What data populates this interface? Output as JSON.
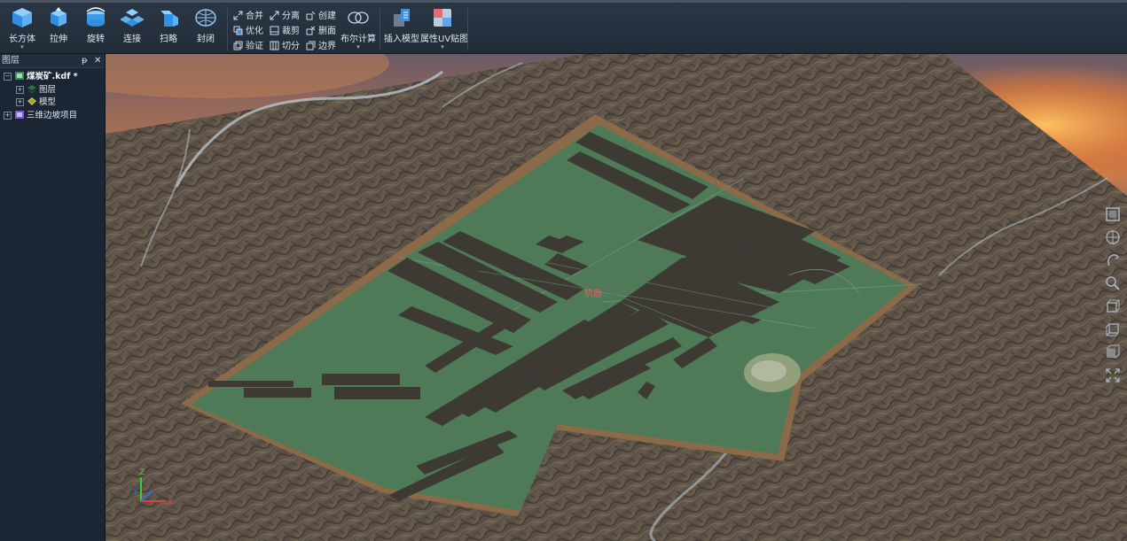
{
  "ribbon": {
    "tools": [
      {
        "label": "长方体",
        "icon": "cube-icon",
        "dropdown": true
      },
      {
        "label": "拉伸",
        "icon": "extrude-icon",
        "dropdown": false
      },
      {
        "label": "旋转",
        "icon": "revolve-icon",
        "dropdown": false
      },
      {
        "label": "连接",
        "icon": "connect-icon",
        "dropdown": false
      },
      {
        "label": "扫略",
        "icon": "sweep-icon",
        "dropdown": false
      },
      {
        "label": "封闭",
        "icon": "close-mesh-icon",
        "dropdown": false
      }
    ],
    "edit_commands": [
      {
        "label": "合并",
        "icon": "merge-icon"
      },
      {
        "label": "分离",
        "icon": "split-icon"
      },
      {
        "label": "创建",
        "icon": "create-icon"
      },
      {
        "label": "优化",
        "icon": "optimize-icon"
      },
      {
        "label": "裁剪",
        "icon": "clip-icon"
      },
      {
        "label": "删面",
        "icon": "delete-face-icon"
      },
      {
        "label": "验证",
        "icon": "validate-icon"
      },
      {
        "label": "切分",
        "icon": "cut-icon"
      },
      {
        "label": "边界",
        "icon": "boundary-icon"
      }
    ],
    "boolean": {
      "label": "布尔计算",
      "icon": "boolean-icon"
    },
    "insert_model": {
      "label": "插入模型",
      "icon": "insert-model-icon"
    },
    "uv_map": {
      "label": "属性UV贴图",
      "icon": "uv-map-icon"
    }
  },
  "layer_panel": {
    "title": "图层",
    "pin_glyph": "ᵽ",
    "close_glyph": "✕",
    "tree": [
      {
        "label": "煤炭矿.kdf *",
        "expander": "−",
        "icon": "scene-file-icon"
      },
      {
        "label": "图层",
        "expander": "+",
        "icon": "layer-icon"
      },
      {
        "label": "模型",
        "expander": "+",
        "icon": "model-icon"
      },
      {
        "label": "三维边坡项目",
        "expander": "+",
        "icon": "project-icon"
      }
    ]
  },
  "viewport": {
    "site_label": "机器",
    "axes": {
      "x": "X",
      "y": "Y",
      "z": "Z"
    }
  },
  "nav_toolbar": [
    "fit-view-icon",
    "pan-icon",
    "rotate-view-icon",
    "zoom-icon",
    "front-view-icon",
    "side-view-icon",
    "iso-view-icon",
    "fullscreen-icon"
  ],
  "colors": {
    "ribbon_bg": "#2b3644",
    "panel_bg": "#1b2533",
    "site_green": "#4f7a58",
    "building_dark": "#3d3a34",
    "border_brown": "#8a6a48",
    "sky_glow": "#f0a040"
  }
}
